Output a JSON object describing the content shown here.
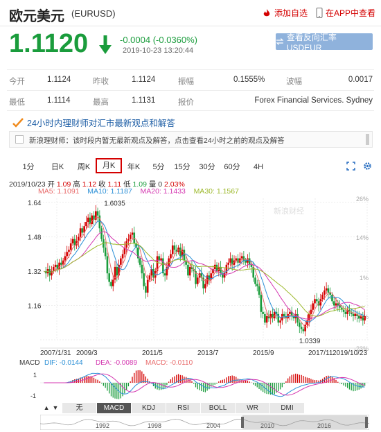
{
  "header": {
    "title": "欧元美元",
    "code": "(EURUSD)",
    "add_label": "添加自选",
    "app_label": "在APP中查看"
  },
  "quote": {
    "price": "1.1120",
    "change": "-0.0004 (-0.0360%)",
    "timestamp": "2019-10-23 13:20:44",
    "reverse_label": "查看反向汇率 USDEUR",
    "color_down": "#1a9c3c",
    "color_up": "#d40000"
  },
  "stats": {
    "open_label": "今开",
    "open": "1.1124",
    "prev_label": "昨收",
    "prev": "1.1124",
    "amp_label": "振幅",
    "amp": "0.1555%",
    "wave_label": "波幅",
    "wave": "0.0017",
    "low_label": "最低",
    "low": "1.1114",
    "high_label": "最高",
    "high": "1.1131",
    "report_label": "报价",
    "report": "Forex Financial Services. Sydney"
  },
  "news": {
    "title": "24小时内理财师对汇市最新观点和解答",
    "text": "新浪理财师：该时段内暂无最新观点及解答，点击查看24小时之前的观点及解答"
  },
  "tabs": [
    {
      "label": "1分",
      "active": false
    },
    {
      "label": "日K",
      "active": false
    },
    {
      "label": "周K",
      "active": false
    },
    {
      "label": "月K",
      "active": true
    },
    {
      "label": "年K",
      "active": false
    },
    {
      "label": "5分",
      "active": false
    },
    {
      "label": "15分",
      "active": false
    },
    {
      "label": "30分",
      "active": false
    },
    {
      "label": "60分",
      "active": false
    },
    {
      "label": "4H",
      "active": false
    }
  ],
  "chart_info": {
    "date": "2019/10/23",
    "open_lbl": "开",
    "open": "1.09",
    "high_lbl": "高",
    "high": "1.12",
    "close_lbl": "收",
    "close": "1.11",
    "low_lbl": "低",
    "low": "1.09",
    "vol_lbl": "量",
    "vol": "0",
    "pct": "2.03%",
    "ma5": "MA5: 1.1091",
    "ma10": "MA10: 1.1187",
    "ma20": "MA20: 1.1433",
    "ma30": "MA30: 1.1567",
    "ma_colors": {
      "ma5": "#e86a6a",
      "ma10": "#2a8fd6",
      "ma20": "#d436b0",
      "ma30": "#9cb82a"
    }
  },
  "chart_data": {
    "type": "candlestick",
    "y_ticks": [
      "1.64",
      "1.48",
      "1.32",
      "1.16"
    ],
    "pct_ticks": [
      "26%",
      "14%",
      "1%",
      "-11%",
      "-23%"
    ],
    "x_ticks": [
      "2007/1/31",
      "2009/3",
      "2011/5",
      "2013/7",
      "2015/9",
      "2017/11",
      "2019/10/23"
    ],
    "annotations": {
      "max": "1.6035",
      "min": "1.0339"
    },
    "ylim": [
      1.0,
      1.66
    ],
    "watermark": "新浪财经",
    "close_series": [
      1.32,
      1.31,
      1.33,
      1.3,
      1.32,
      1.34,
      1.35,
      1.33,
      1.36,
      1.35,
      1.37,
      1.39,
      1.41,
      1.42,
      1.45,
      1.47,
      1.44,
      1.46,
      1.48,
      1.52,
      1.5,
      1.53,
      1.55,
      1.57,
      1.54,
      1.58,
      1.56,
      1.6,
      1.58,
      1.52,
      1.47,
      1.43,
      1.39,
      1.31,
      1.27,
      1.25,
      1.28,
      1.34,
      1.3,
      1.35,
      1.38,
      1.4,
      1.43,
      1.46,
      1.47,
      1.49,
      1.5,
      1.45,
      1.43,
      1.38,
      1.35,
      1.31,
      1.25,
      1.22,
      1.28,
      1.3,
      1.33,
      1.29,
      1.32,
      1.39,
      1.37,
      1.38,
      1.31,
      1.3,
      1.34,
      1.38,
      1.4,
      1.44,
      1.42,
      1.41,
      1.43,
      1.39,
      1.42,
      1.37,
      1.35,
      1.3,
      1.34,
      1.33,
      1.32,
      1.26,
      1.29,
      1.31,
      1.29,
      1.24,
      1.26,
      1.3,
      1.28,
      1.31,
      1.33,
      1.35,
      1.32,
      1.34,
      1.31,
      1.29,
      1.31,
      1.35,
      1.36,
      1.38,
      1.35,
      1.37,
      1.38,
      1.36,
      1.38,
      1.39,
      1.37,
      1.36,
      1.38,
      1.35,
      1.34,
      1.29,
      1.26,
      1.25,
      1.21,
      1.13,
      1.12,
      1.08,
      1.11,
      1.1,
      1.12,
      1.1,
      1.13,
      1.12,
      1.08,
      1.09,
      1.12,
      1.11,
      1.1,
      1.12,
      1.13,
      1.11,
      1.1,
      1.12,
      1.08,
      1.06,
      1.05,
      1.04,
      1.07,
      1.09,
      1.12,
      1.14,
      1.17,
      1.19,
      1.18,
      1.16,
      1.19,
      1.21,
      1.23,
      1.24,
      1.22,
      1.21,
      1.18,
      1.16,
      1.17,
      1.16,
      1.15,
      1.14,
      1.13,
      1.12,
      1.14,
      1.13,
      1.12,
      1.11,
      1.12,
      1.11,
      1.1,
      1.11,
      1.09,
      1.11
    ]
  },
  "macd": {
    "label": "MACD",
    "dif": "DIF: -0.0144",
    "dea": "DEA: -0.0089",
    "macd": "MACD: -0.0110",
    "y_ticks": [
      "1",
      "-1"
    ]
  },
  "indicators": [
    {
      "label": "无",
      "active": false
    },
    {
      "label": "MACD",
      "active": true
    },
    {
      "label": "KDJ",
      "active": false
    },
    {
      "label": "RSI",
      "active": false
    },
    {
      "label": "BOLL",
      "active": false
    },
    {
      "label": "WR",
      "active": false
    },
    {
      "label": "DMI",
      "active": false
    }
  ],
  "range_ticks": [
    "1992",
    "1998",
    "2004",
    "2010",
    "2016"
  ]
}
